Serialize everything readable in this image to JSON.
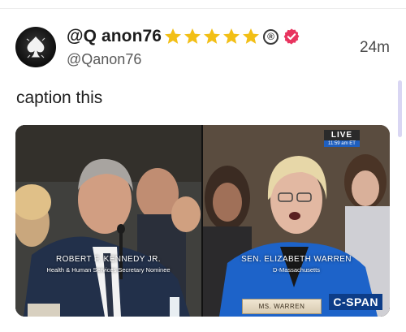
{
  "post": {
    "display_name": "@Q anon76",
    "handle": "@Qanon76",
    "timestamp": "24m",
    "caption": "caption this",
    "reg_mark": "®",
    "colors": {
      "star": "#F2BF16",
      "verified": "#E8345F",
      "accent": "#1F5FBF"
    }
  },
  "media": {
    "left": {
      "name": "ROBERT F. KENNEDY JR.",
      "title": "Health & Human Services Secretary Nominee"
    },
    "right": {
      "name": "SEN. ELIZABETH WARREN",
      "title": "D-Massachusetts",
      "live_label": "LIVE",
      "live_time": "11:59 am ET",
      "network": "C-SPAN",
      "nameplate": "MS. WARREN"
    }
  }
}
